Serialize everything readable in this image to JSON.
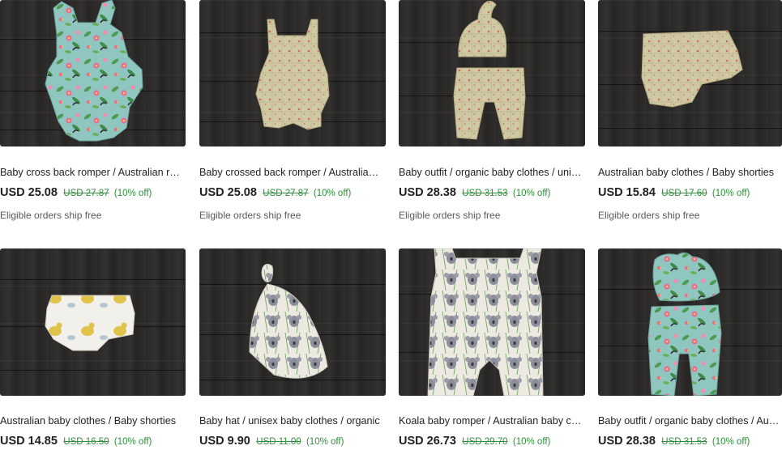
{
  "listings": [
    {
      "title": "Baby cross back romper / Australian romper",
      "price": "USD 25.08",
      "original_price": "USD 27.87",
      "discount": "(10% off)",
      "shipping": "Eligible orders ship free",
      "fabric": "floral"
    },
    {
      "title": "Baby crossed back romper / Australian romper",
      "price": "USD 25.08",
      "original_price": "USD 27.87",
      "discount": "(10% off)",
      "shipping": "Eligible orders ship free",
      "fabric": "check"
    },
    {
      "title": "Baby outfit / organic baby clothes / unisex",
      "price": "USD 28.38",
      "original_price": "USD 31.53",
      "discount": "(10% off)",
      "shipping": "Eligible orders ship free",
      "fabric": "check"
    },
    {
      "title": "Australian baby clothes / Baby shorties",
      "price": "USD 15.84",
      "original_price": "USD 17.60",
      "discount": "(10% off)",
      "shipping": "Eligible orders ship free",
      "fabric": "check"
    },
    {
      "title": "Australian baby clothes / Baby shorties",
      "price": "USD 14.85",
      "original_price": "USD 16.50",
      "discount": "(10% off)",
      "fabric": "duck"
    },
    {
      "title": "Baby hat / unisex baby clothes / organic",
      "price": "USD 9.90",
      "original_price": "USD 11.00",
      "discount": "(10% off)",
      "fabric": "koala"
    },
    {
      "title": "Koala baby romper / Australian baby clothes",
      "price": "USD 26.73",
      "original_price": "USD 29.70",
      "discount": "(10% off)",
      "fabric": "koala"
    },
    {
      "title": "Baby outfit / organic baby clothes / Australian",
      "price": "USD 28.38",
      "original_price": "USD 31.53",
      "discount": "(10% off)",
      "fabric": "floral"
    }
  ],
  "colors": {
    "discount": "#2f8f3b",
    "background_wood": "#2d2b2a",
    "title": "#222222",
    "muted": "#595959"
  }
}
